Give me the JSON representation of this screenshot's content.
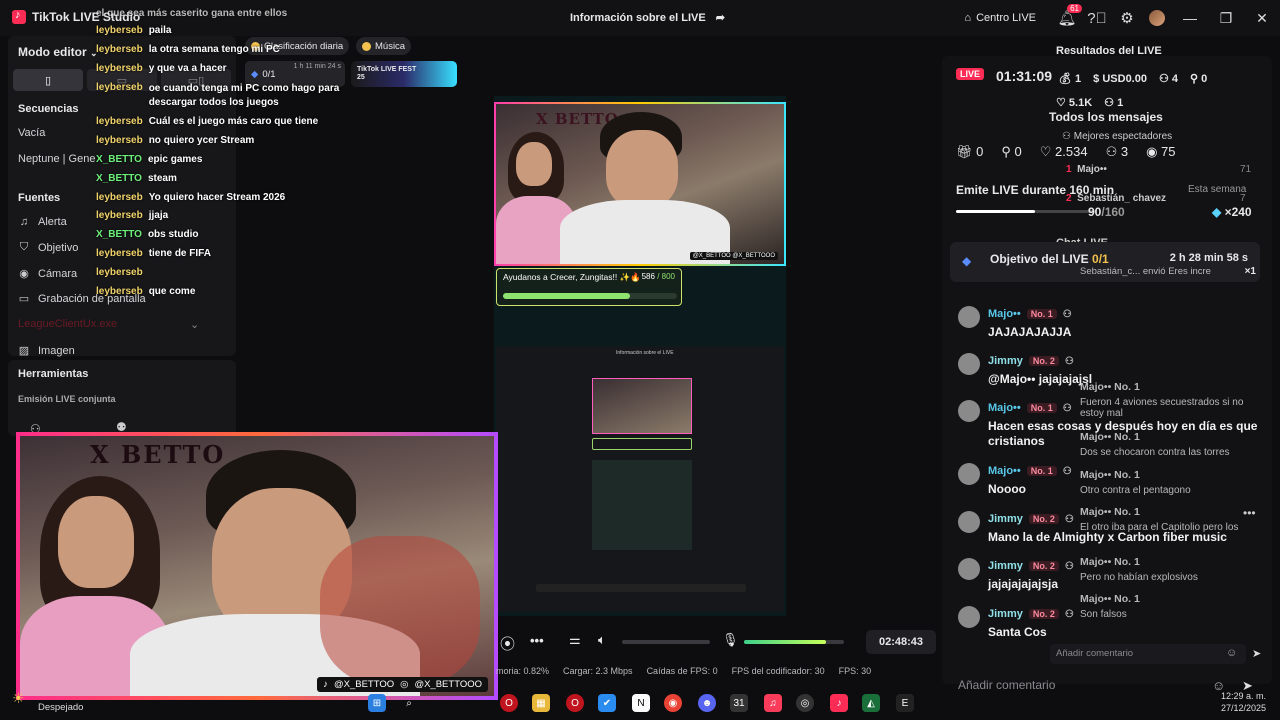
{
  "app": {
    "name": "TikTok LIVE Studio",
    "window_title": "Información sobre el LIVE",
    "centro_live": "Centro LIVE",
    "notification_count": "61"
  },
  "left_panel": {
    "mode_label": "Modo editor",
    "secuencias_title": "Secuencias",
    "secuencias_items": [
      "Vacía",
      "Neptune | Gene"
    ],
    "fuentes_title": "Fuentes",
    "fuentes_items": [
      "Alerta",
      "Objetivo",
      "Cámara",
      "Grabación de pantalla",
      "LeagueClientUx.exe",
      "Imagen"
    ],
    "herramientas_title": "Herramientas",
    "emision_label": "Emisión LIVE conjunta"
  },
  "overlay_chat": [
    {
      "name": "leyberseb",
      "msg": "paila",
      "green": false
    },
    {
      "name": "leyberseb",
      "msg": "la otra semana tengo mi PC",
      "green": false
    },
    {
      "name": "leyberseb",
      "msg": "y que va a hacer",
      "green": false
    },
    {
      "name": "leyberseb",
      "msg": "oe cuando tenga mi PC como hago para descargar todos los juegos",
      "green": false
    },
    {
      "name": "leyberseb",
      "msg": "Cuál es el juego más caro que tiene",
      "green": false
    },
    {
      "name": "leyberseb",
      "msg": "no quiero ycer Stream",
      "green": false
    },
    {
      "name": "X_BETTO",
      "msg": "epic games",
      "green": true
    },
    {
      "name": "X_BETTO",
      "msg": "steam",
      "green": true
    },
    {
      "name": "leyberseb",
      "msg": "Yo quiero hacer Stream 2026",
      "green": false
    },
    {
      "name": "leyberseb",
      "msg": "jjaja",
      "green": false
    },
    {
      "name": "X_BETTO",
      "msg": "obs studio",
      "green": true
    },
    {
      "name": "leyberseb",
      "msg": "tiene de FIFA",
      "green": false
    },
    {
      "name": "leyberseb",
      "msg": "",
      "green": false
    },
    {
      "name": "leyberseb",
      "msg": "que come",
      "green": false
    }
  ],
  "overlay_top_line": "el que sea más caserito gana entre ellos",
  "chips": {
    "clasificacion": "Clasificación diaria",
    "musica": "Música",
    "goal_count": "0/1",
    "goal_timer": "1 h 11 min 24 s",
    "fest": "TikTok LIVE FEST 25"
  },
  "preview": {
    "brand": "X BETTO",
    "goal_title": "Ayudanos a Crecer, Zungitas!! ✨🔥",
    "goal_count": "586",
    "goal_total": "/ 800",
    "goal_progress": 0.73,
    "cam_tag": "@X_BETTOO @X_BETTOOO",
    "nested_header": "Información sobre el LIVE"
  },
  "big_cam": {
    "brand": "X BETTO",
    "tiktok_handle": "@X_BETTOO",
    "ig_handle": "@X_BETTOOO"
  },
  "controls": {
    "elapsed": "02:48:43",
    "volume_level": 0.0,
    "mic_level": 0.82
  },
  "stats": {
    "memoria": "moria: 0.82%",
    "cargar": "Cargar: 2.3 Mbps",
    "caidas": "Caídas de FPS: 0",
    "fps_cod": "FPS del codificador: 30",
    "fps": "FPS: 30"
  },
  "right_panel": {
    "resultados_title": "Resultados del LIVE",
    "live_label": "LIVE",
    "live_time": "01:31:09",
    "gifts": "1",
    "usd": "USD0.00",
    "viewers_now": "4",
    "follows": "0",
    "likes_small": "5.1K",
    "viewers_small": "1",
    "todos_mensajes": "Todos los mensajes",
    "mejores": "Mejores espectadores",
    "big_gifts": "0",
    "big_follows": "0",
    "big_likes": "2.534",
    "big_members": "3",
    "big_views": "75",
    "emite_label": "Emite LIVE durante 160 min",
    "esta_semana": "Esta semana",
    "emite_progress": "90",
    "emite_total": "/160",
    "emite_fraction": 0.5625,
    "gems": "×240",
    "chat_live": "Chat LIVE",
    "objetivo_label": "Objetivo del LIVE",
    "objetivo_count": "0/1",
    "objetivo_timer": "2 h 28 min 58 s",
    "ghost_gift": "Sebastián_c... envió Eres incre",
    "ghost_gift_x": "×1",
    "majo_71": "Majo••",
    "num_71": "71",
    "sebastian": "Sebastián_ chavez",
    "num_7": "7"
  },
  "messages": [
    {
      "name": "Majo••",
      "rank": "No. 1",
      "text": "JAJAJAJAJJA"
    },
    {
      "name": "Jimmy",
      "rank": "No. 2",
      "text": "@Majo•• jajajajajsl"
    },
    {
      "name": "Majo••",
      "rank": "No. 1",
      "text": "Hacen esas cosas y después hoy en día es que cristianos"
    },
    {
      "name": "Majo••",
      "rank": "No. 1",
      "text": "Noooo"
    },
    {
      "name": "Jimmy",
      "rank": "No. 2",
      "text": "Mano la de Almighty x Carbon fiber music"
    },
    {
      "name": "Jimmy",
      "rank": "No. 2",
      "text": "jajajajajajsja"
    },
    {
      "name": "Jimmy",
      "rank": "No. 2",
      "text": "Santa Cos"
    }
  ],
  "ghost_messages": [
    {
      "head": "Majo•• No. 1",
      "text": "Fueron 4 aviones secuestrados si no estoy mal"
    },
    {
      "head": "Majo•• No. 1",
      "text": "Dos se chocaron contra las torres"
    },
    {
      "head": "Majo•• No. 1",
      "text": "Otro contra el pentagono"
    },
    {
      "head": "Majo•• No. 1",
      "text": "El otro iba para el Capitolio pero los"
    },
    {
      "head": "Majo•• No. 1",
      "text": "Pero no habían explosivos"
    },
    {
      "head": "Majo•• No. 1",
      "text": "Son falsos"
    }
  ],
  "comment": {
    "placeholder": "Añadir comentario",
    "small_placeholder": "Añadir comentario"
  },
  "taskbar": {
    "weather": "Despejado",
    "time": "12:29 a. m.",
    "date": "27/12/2025"
  }
}
